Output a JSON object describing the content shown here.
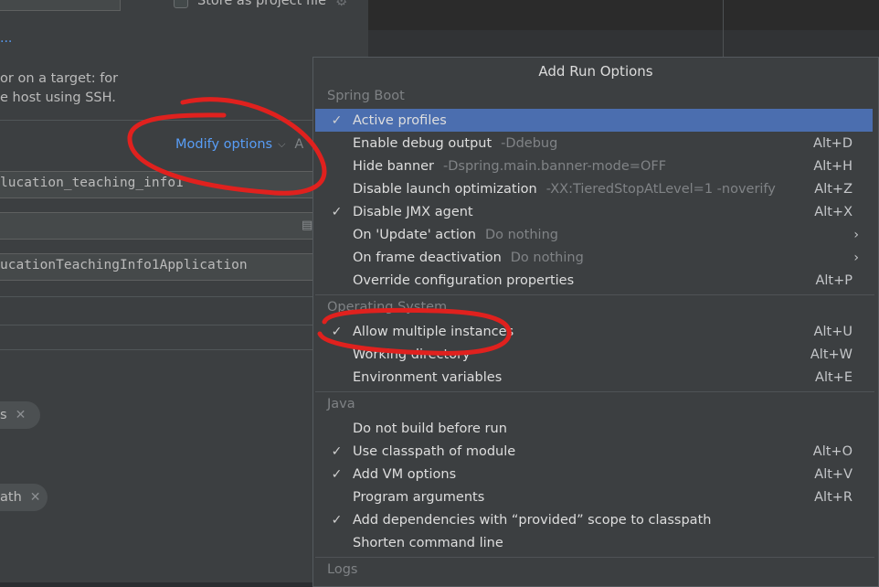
{
  "background": {
    "store_checkbox_label": "Store as project file",
    "link_dots": "...",
    "description_line1": "or on a target: for",
    "description_line2": "e host using SSH.",
    "modify_options_label": "Modify options",
    "modify_options_shortcut_partial": "A",
    "module_field_value": "lucation_teaching_info1",
    "main_class_field_value": "ucationTeachingInfo1Application",
    "chip1_label": "s",
    "chip2_label": "ath"
  },
  "popup": {
    "title": "Add Run Options",
    "sections": [
      {
        "header": "Spring Boot",
        "items": [
          {
            "label": "Active profiles",
            "hint": "",
            "shortcut": "",
            "checked": true,
            "selected": true,
            "submenu": false
          },
          {
            "label": "Enable debug output",
            "hint": "-Ddebug",
            "shortcut": "Alt+D",
            "checked": false,
            "selected": false,
            "submenu": false
          },
          {
            "label": "Hide banner",
            "hint": "-Dspring.main.banner-mode=OFF",
            "shortcut": "Alt+H",
            "checked": false,
            "selected": false,
            "submenu": false
          },
          {
            "label": "Disable launch optimization",
            "hint": "-XX:TieredStopAtLevel=1 -noverify",
            "shortcut": "Alt+Z",
            "checked": false,
            "selected": false,
            "submenu": false
          },
          {
            "label": "Disable JMX agent",
            "hint": "",
            "shortcut": "Alt+X",
            "checked": true,
            "selected": false,
            "submenu": false
          },
          {
            "label": "On 'Update' action",
            "hint": "Do nothing",
            "shortcut": "",
            "checked": false,
            "selected": false,
            "submenu": true
          },
          {
            "label": "On frame deactivation",
            "hint": "Do nothing",
            "shortcut": "",
            "checked": false,
            "selected": false,
            "submenu": true
          },
          {
            "label": "Override configuration properties",
            "hint": "",
            "shortcut": "Alt+P",
            "checked": false,
            "selected": false,
            "submenu": false
          }
        ]
      },
      {
        "header": "Operating System",
        "items": [
          {
            "label": "Allow multiple instances",
            "hint": "",
            "shortcut": "Alt+U",
            "checked": true,
            "selected": false,
            "submenu": false
          },
          {
            "label": "Working directory",
            "hint": "",
            "shortcut": "Alt+W",
            "checked": false,
            "selected": false,
            "submenu": false
          },
          {
            "label": "Environment variables",
            "hint": "",
            "shortcut": "Alt+E",
            "checked": false,
            "selected": false,
            "submenu": false
          }
        ]
      },
      {
        "header": "Java",
        "items": [
          {
            "label": "Do not build before run",
            "hint": "",
            "shortcut": "",
            "checked": false,
            "selected": false,
            "submenu": false
          },
          {
            "label": "Use classpath of module",
            "hint": "",
            "shortcut": "Alt+O",
            "checked": true,
            "selected": false,
            "submenu": false
          },
          {
            "label": "Add VM options",
            "hint": "",
            "shortcut": "Alt+V",
            "checked": true,
            "selected": false,
            "submenu": false
          },
          {
            "label": "Program arguments",
            "hint": "",
            "shortcut": "Alt+R",
            "checked": false,
            "selected": false,
            "submenu": false
          },
          {
            "label": "Add dependencies with “provided” scope to classpath",
            "hint": "",
            "shortcut": "",
            "checked": true,
            "selected": false,
            "submenu": false
          },
          {
            "label": "Shorten command line",
            "hint": "",
            "shortcut": "",
            "checked": false,
            "selected": false,
            "submenu": false
          }
        ]
      },
      {
        "header": "Logs",
        "items": []
      }
    ]
  },
  "colors": {
    "selection": "#4b6eaf",
    "link": "#589df6",
    "annotation": "#e0211e"
  },
  "icons": {
    "check": "checkmark-icon",
    "submenu": "chevron-right-icon",
    "chip_close": "close-icon",
    "dropdown": "chevron-down-icon"
  }
}
